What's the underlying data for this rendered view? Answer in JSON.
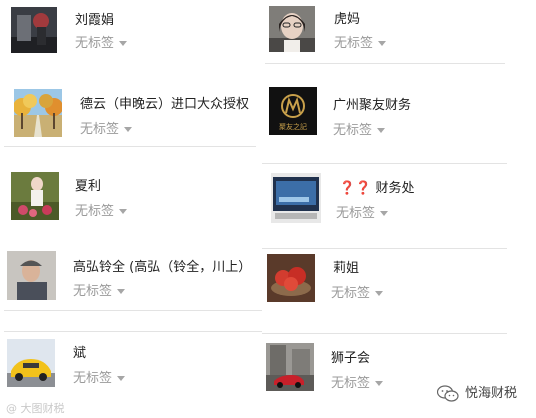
{
  "contacts": [
    {
      "name": "刘霞娟",
      "tag": "无标签"
    },
    {
      "name": "虎妈",
      "tag": "无标签"
    },
    {
      "name": "德云（申晚云）进口大众授权",
      "tag": "无标签"
    },
    {
      "name": "广州聚友财务",
      "tag": "无标签",
      "avatar_text": "聚友之記"
    },
    {
      "name": "夏利",
      "tag": "无标签"
    },
    {
      "name_prefix": "❓❓",
      "name": "财务处",
      "tag": "无标签"
    },
    {
      "name": "高弘铃全 (高弘（铃全，川上）",
      "tag": "无标签"
    },
    {
      "name": "莉姐",
      "tag": "无标签"
    },
    {
      "name": "斌",
      "tag": "无标签"
    },
    {
      "name": "狮子会",
      "tag": "无标签"
    }
  ],
  "watermark": {
    "left_text": "@ 大图财税"
  },
  "brand": {
    "name": "悦海财税",
    "icon": "wechat-icon"
  },
  "colors": {
    "name_text": "#222222",
    "tag_text": "#9a9a9a",
    "divider": "#e3e3e3",
    "question_mark": "#c0272d"
  }
}
